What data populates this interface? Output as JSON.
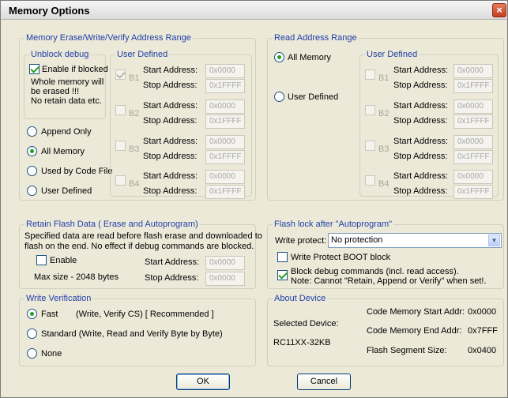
{
  "window": {
    "title": "Memory Options",
    "close_glyph": "×"
  },
  "mem_range": {
    "legend": "Memory Erase/Write/Verify Address Range",
    "unblock": {
      "legend": "Unblock debug",
      "enable_label": "Enable if blocked",
      "enable_checked": true,
      "warning_lines": [
        "Whole memory will",
        "be erased !!!",
        "No retain data etc."
      ]
    },
    "radios": [
      {
        "label": "Append Only",
        "selected": false
      },
      {
        "label": "All Memory",
        "selected": true
      },
      {
        "label": "Used by Code File",
        "selected": false
      },
      {
        "label": "User Defined",
        "selected": false
      }
    ],
    "user_defined": {
      "legend": "User Defined",
      "start_label": "Start Address:",
      "stop_label": "Stop Address:",
      "banks": [
        {
          "name": "B1",
          "checked": true,
          "start": "0x0000",
          "stop": "0x1FFFF"
        },
        {
          "name": "B2",
          "checked": false,
          "start": "0x0000",
          "stop": "0x1FFFF"
        },
        {
          "name": "B3",
          "checked": false,
          "start": "0x0000",
          "stop": "0x1FFFF"
        },
        {
          "name": "B4",
          "checked": false,
          "start": "0x0000",
          "stop": "0x1FFFF"
        }
      ]
    }
  },
  "read_range": {
    "legend": "Read Address Range",
    "radios": [
      {
        "label": "All Memory",
        "selected": true
      },
      {
        "label": "User Defined",
        "selected": false
      }
    ],
    "user_defined": {
      "legend": "User Defined",
      "start_label": "Start Address:",
      "stop_label": "Stop Address:",
      "banks": [
        {
          "name": "B1",
          "checked": false,
          "start": "0x0000",
          "stop": "0x1FFFF"
        },
        {
          "name": "B2",
          "checked": false,
          "start": "0x0000",
          "stop": "0x1FFFF"
        },
        {
          "name": "B3",
          "checked": false,
          "start": "0x0000",
          "stop": "0x1FFFF"
        },
        {
          "name": "B4",
          "checked": false,
          "start": "0x0000",
          "stop": "0x1FFFF"
        }
      ]
    }
  },
  "retain": {
    "legend": "Retain Flash Data ( Erase and Autoprogram)",
    "desc_lines": [
      "Specified data are read before flash erase and downloaded to",
      "flash on the end. No effect if debug commands are blocked."
    ],
    "enable_label": "Enable",
    "enable_checked": false,
    "max_size": "Max size - 2048 bytes",
    "start_label": "Start Address:",
    "start_value": "0x0000",
    "stop_label": "Stop Address:",
    "stop_value": "0x0000"
  },
  "flash_lock": {
    "legend": "Flash lock after \"Autoprogram\"",
    "write_protect_label": "Write protect:",
    "write_protect_value": "No protection",
    "boot_label": "Write Protect BOOT block",
    "boot_checked": false,
    "block_debug_lines": [
      "Block debug commands (incl. read access).",
      "Note: Cannot \"Retain, Append or Verify\" when set!."
    ],
    "block_debug_checked": true
  },
  "write_verify": {
    "legend": "Write Verification",
    "options": [
      {
        "label": "Fast",
        "detail": "(Write, Verify CS)  [ Recommended ]",
        "selected": true
      },
      {
        "label": "Standard  (Write, Read and Verify Byte by Byte)",
        "detail": "",
        "selected": false
      },
      {
        "label": "None",
        "detail": "",
        "selected": false
      }
    ]
  },
  "about": {
    "legend": "About Device",
    "selected_device_label": "Selected Device:",
    "device_name": "RC11XX-32KB",
    "code_start_label": "Code Memory Start Addr:",
    "code_start": "0x0000",
    "code_end_label": "Code Memory End Addr:",
    "code_end": "0x7FFF",
    "segment_label": "Flash Segment Size:",
    "segment": "0x0400"
  },
  "buttons": {
    "ok": "OK",
    "cancel": "Cancel"
  }
}
